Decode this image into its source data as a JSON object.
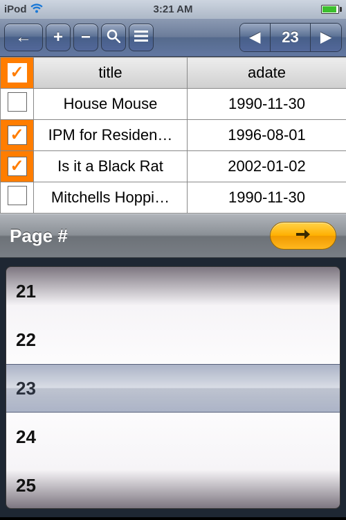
{
  "status": {
    "device": "iPod",
    "time": "3:21 AM"
  },
  "toolbar": {
    "current_page": "23"
  },
  "table": {
    "header_all_checked": true,
    "columns": {
      "title": "title",
      "adate": "adate"
    },
    "rows": [
      {
        "checked": false,
        "title": "House Mouse",
        "adate": "1990-11-30"
      },
      {
        "checked": true,
        "title": "IPM for Residen…",
        "adate": "1996-08-01"
      },
      {
        "checked": true,
        "title": "Is it a Black Rat",
        "adate": "2002-01-02"
      },
      {
        "checked": false,
        "title": "Mitchells Hoppi…",
        "adate": "1990-11-30"
      }
    ]
  },
  "pagebar": {
    "label": "Page #"
  },
  "picker": {
    "items": [
      "21",
      "22",
      "23",
      "24",
      "25"
    ],
    "selected_index": 2
  }
}
